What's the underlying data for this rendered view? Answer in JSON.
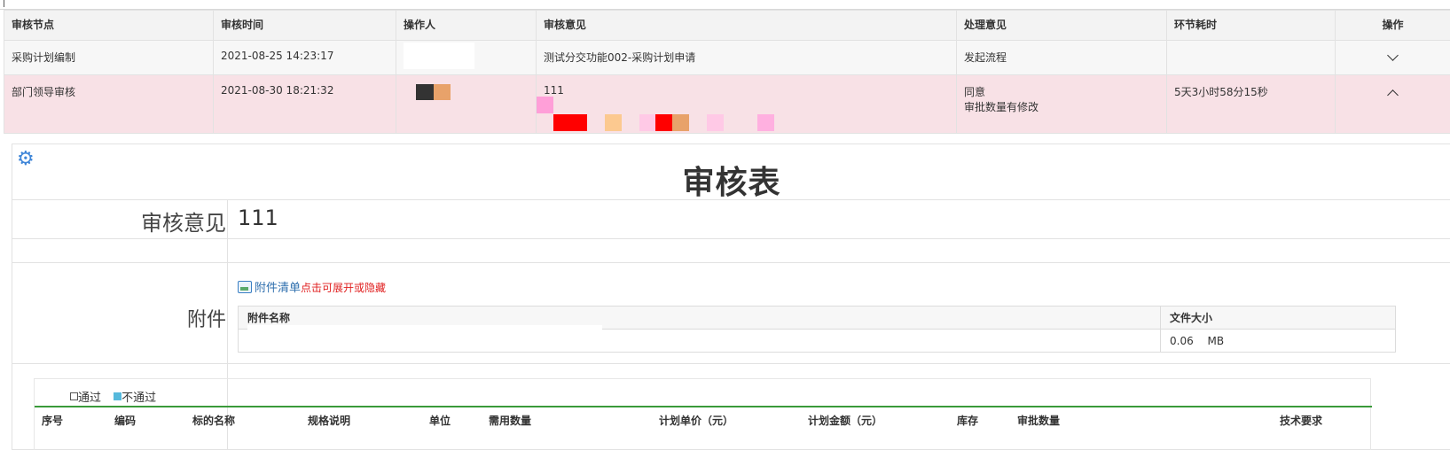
{
  "history": {
    "headers": [
      "审核节点",
      "审核时间",
      "操作人",
      "审核意见",
      "处理意见",
      "环节耗时",
      "操作"
    ],
    "rows": [
      {
        "node": "采购计划编制",
        "time": "2021-08-25 14:23:17",
        "operator": "",
        "opinion": "测试分交功能002-采购计划申请",
        "handle_line1": "发起流程",
        "handle_line2": "",
        "duration": "",
        "toggle_icon": "chevron-down-icon"
      },
      {
        "node": "部门领导审核",
        "time": "2021-08-30 18:21:32",
        "operator": "",
        "opinion": "111",
        "handle_line1": "同意",
        "handle_line2": "审批数量有修改",
        "duration": "5天3小时58分15秒",
        "toggle_icon": "chevron-up-icon"
      }
    ]
  },
  "form": {
    "settings_icon": "gear-icon",
    "title": "审核表",
    "opinion_label": "审核意见",
    "opinion_value": "111",
    "attachment_label": "附件",
    "attachment_list_label": "附件清单",
    "attachment_toggle_hint": "点击可展开或隐藏",
    "files": {
      "headers": [
        "附件名称",
        "文件大小"
      ],
      "rows": [
        {
          "name": "",
          "size": "0.06",
          "unit": "MB"
        }
      ]
    }
  },
  "items": {
    "legend_pass": "通过",
    "legend_fail": "不通过",
    "columns": [
      "序号",
      "编码",
      "标的名称",
      "规格说明",
      "单位",
      "需用数量",
      "计划单价（元）",
      "计划金额（元）",
      "库存",
      "审批数量",
      "技术要求"
    ]
  },
  "colors": {
    "highlight_row": "#f8e1e6",
    "header_bg": "#f3f3f3",
    "accent_blue": "#2f6fae",
    "hint_red": "#e02020",
    "legend_fail_box": "#56b9dc",
    "divider_green": "#3a9a3a"
  }
}
